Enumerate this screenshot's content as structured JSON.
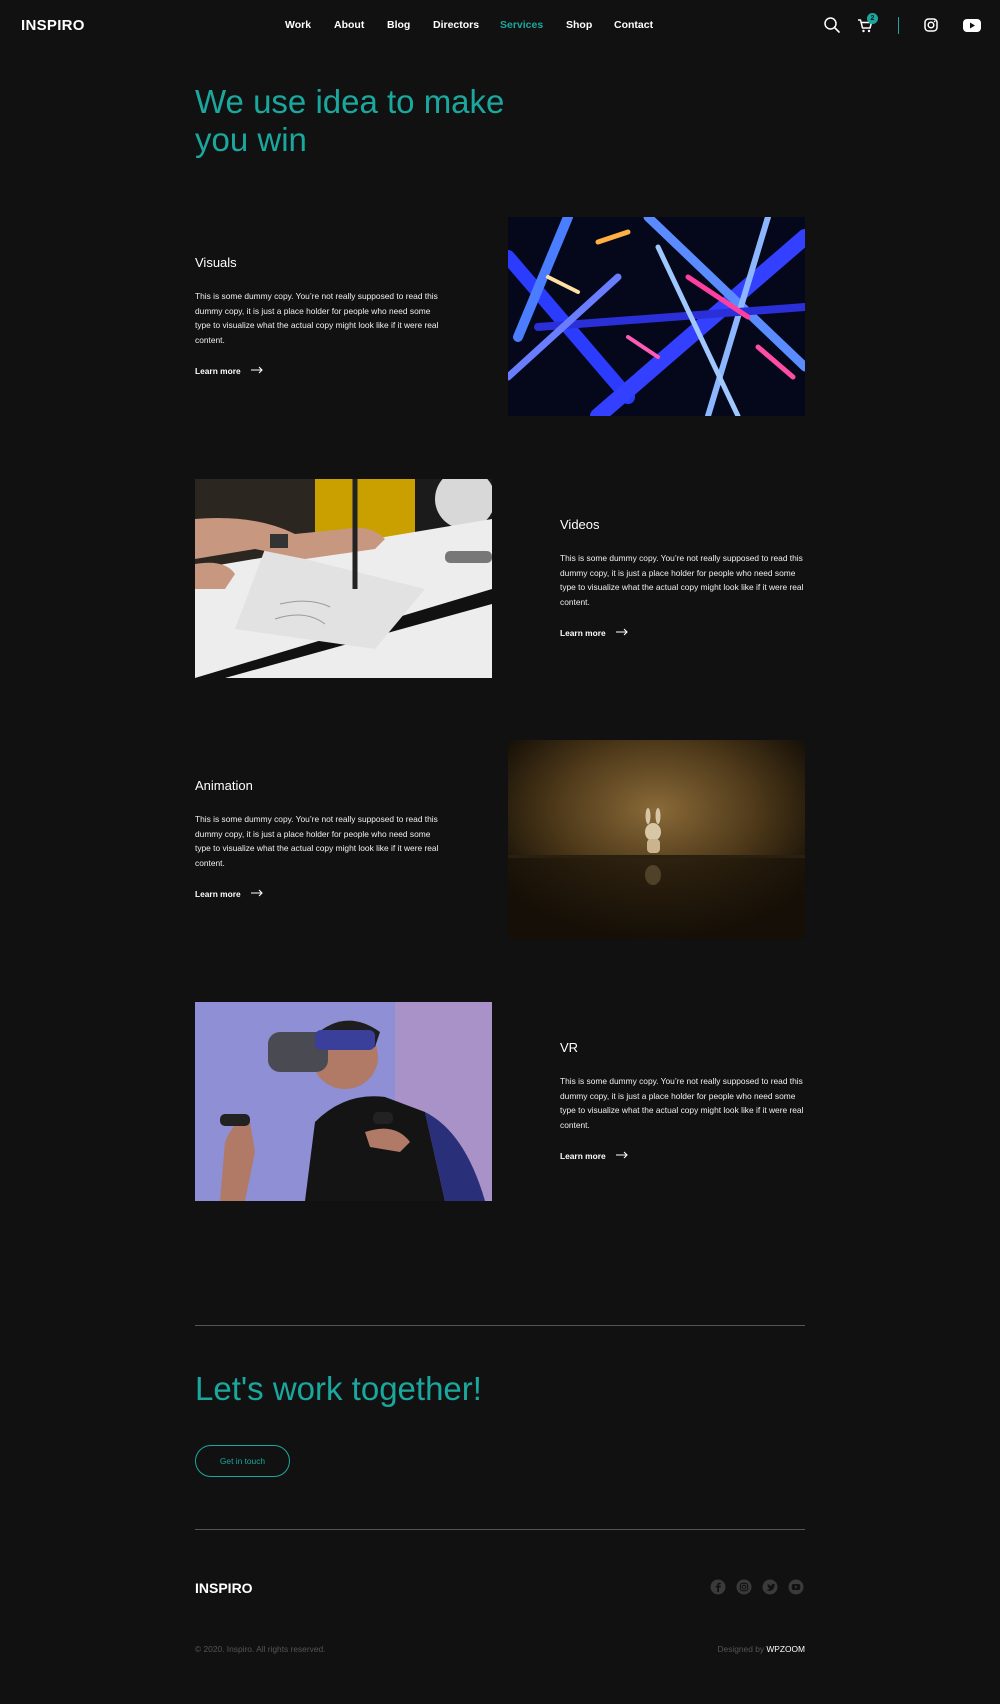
{
  "brand": "INSPIRO",
  "nav": {
    "items": [
      "Work",
      "About",
      "Blog",
      "Directors",
      "Services",
      "Shop",
      "Contact"
    ],
    "active": "Services"
  },
  "header_icons": [
    "search-icon",
    "cart-icon",
    "instagram-icon",
    "youtube-icon"
  ],
  "cart": {
    "count": "2"
  },
  "hero": {
    "title": "We use idea to make you win"
  },
  "services": [
    {
      "title": "Visuals",
      "text": "This is some dummy copy. You’re not really supposed to read this dummy copy, it is just a place holder for people who need some type to visualize what the actual copy might look like if it were real content.",
      "link": "Learn more"
    },
    {
      "title": "Videos",
      "text": "This is some dummy copy. You’re not really supposed to read this dummy copy, it is just a place holder for people who need some type to visualize what the actual copy might look like if it were real content.",
      "link": "Learn more"
    },
    {
      "title": "Animation",
      "text": "This is some dummy copy. You’re not really supposed to read this dummy copy, it is just a place holder for people who need some type to visualize what the actual copy might look like if it were real content.",
      "link": "Learn more"
    },
    {
      "title": "VR",
      "text": "This is some dummy copy. You’re not really supposed to read this dummy copy, it is just a place holder for people who need some type to visualize what the actual copy might look like if it were real content.",
      "link": "Learn more"
    }
  ],
  "cta": {
    "title": "Let's work together!",
    "button": "Get in touch"
  },
  "footer": {
    "brand": "INSPIRO",
    "social_icons": [
      "facebook-icon",
      "instagram-icon",
      "twitter-icon",
      "youtube-icon"
    ],
    "copyright": "© 2020. Inspiro. All rights reserved.",
    "designed_prefix": "Designed by ",
    "designed_by": "WPZOOM"
  },
  "colors": {
    "accent": "#1aa89e",
    "background": "#111111",
    "text": "#ffffff",
    "muted": "#555555"
  }
}
